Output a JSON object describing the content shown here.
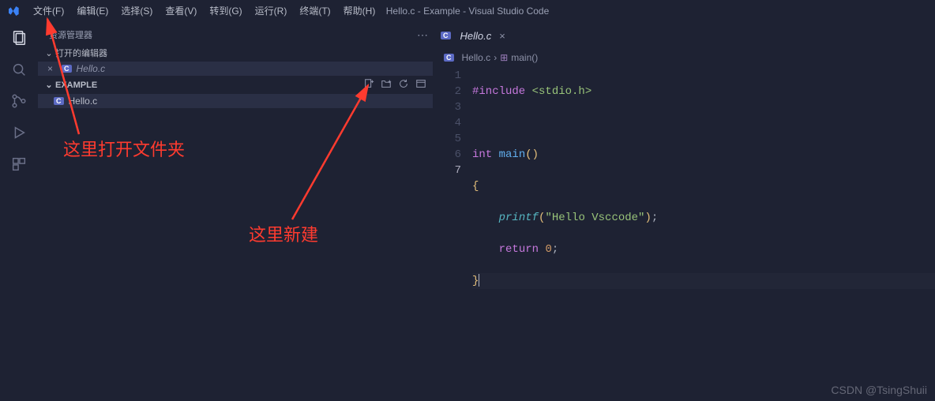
{
  "titlebar": {
    "title": "Hello.c - Example - Visual Studio Code",
    "menu": [
      "文件(F)",
      "编辑(E)",
      "选择(S)",
      "查看(V)",
      "转到(G)",
      "运行(R)",
      "终端(T)",
      "帮助(H)"
    ]
  },
  "sidebar": {
    "title": "资源管理器",
    "openEditors": {
      "label": "打开的编辑器",
      "items": [
        "Hello.c"
      ]
    },
    "folder": {
      "name": "EXAMPLE",
      "items": [
        "Hello.c"
      ]
    }
  },
  "editor": {
    "tab": {
      "label": "Hello.c",
      "lang": "C"
    },
    "breadcrumb": {
      "file": "Hello.c",
      "symbol": "main()"
    },
    "lines": [
      "1",
      "2",
      "3",
      "4",
      "5",
      "6",
      "7"
    ],
    "code": {
      "l1_pp": "#include",
      "l1_inc": " <stdio.h>",
      "l3_type": "int",
      "l3_fn": " main",
      "l3_par": "()",
      "l4": "{",
      "l5_indent": "    ",
      "l5_call": "printf",
      "l5_open": "(",
      "l5_str": "\"Hello Vsccode\"",
      "l5_close": ")",
      "l5_semi": ";",
      "l6_indent": "    ",
      "l6_kw": "return",
      "l6_sp": " ",
      "l6_num": "0",
      "l6_semi": ";",
      "l7": "}"
    }
  },
  "annotations": {
    "a1": "这里打开文件夹",
    "a2": "这里新建"
  },
  "watermark": "CSDN @TsingShuii",
  "icons": {
    "langBadge": "C"
  }
}
